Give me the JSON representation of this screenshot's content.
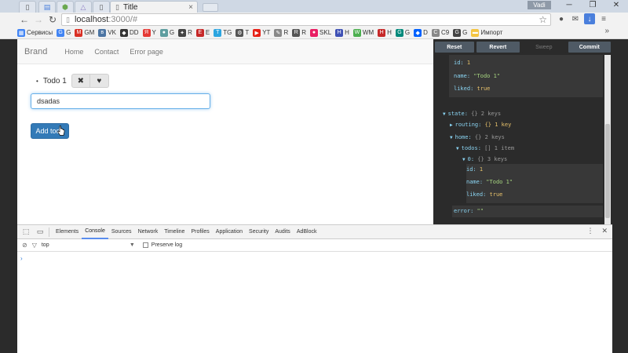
{
  "browser": {
    "tab_title": "Title",
    "url_host": "localhost",
    "url_rest": ":3000/#",
    "user_label": "Vadi",
    "bookmarks": [
      {
        "label": "Сервисы",
        "color": "#4285f4",
        "glyph": "▦"
      },
      {
        "label": "G",
        "color": "#4285f4",
        "glyph": "G"
      },
      {
        "label": "GM",
        "color": "#d93025",
        "glyph": "M"
      },
      {
        "label": "VK",
        "color": "#4c75a3",
        "glyph": "в"
      },
      {
        "label": "DD",
        "color": "#333333",
        "glyph": "◆"
      },
      {
        "label": "Y",
        "color": "#e53935",
        "glyph": "Я"
      },
      {
        "label": "G",
        "color": "#5f9ea0",
        "glyph": "●"
      },
      {
        "label": "R",
        "color": "#444444",
        "glyph": "✦"
      },
      {
        "label": "E",
        "color": "#c62828",
        "glyph": "E"
      },
      {
        "label": "TG",
        "color": "#2ca5e0",
        "glyph": "T"
      },
      {
        "label": "T",
        "color": "#555555",
        "glyph": "⚙"
      },
      {
        "label": "YT",
        "color": "#e62117",
        "glyph": "▶"
      },
      {
        "label": "R",
        "color": "#888888",
        "glyph": "✎"
      },
      {
        "label": "R",
        "color": "#555555",
        "glyph": "R"
      },
      {
        "label": "SKL",
        "color": "#e91e63",
        "glyph": "●"
      },
      {
        "label": "H",
        "color": "#3f51b5",
        "glyph": "H"
      },
      {
        "label": "WM",
        "color": "#4caf50",
        "glyph": "W"
      },
      {
        "label": "H",
        "color": "#c62828",
        "glyph": "H"
      },
      {
        "label": "G",
        "color": "#00897b",
        "glyph": "G"
      },
      {
        "label": "D",
        "color": "#0061fe",
        "glyph": "◆"
      },
      {
        "label": "C9",
        "color": "#888888",
        "glyph": "C"
      },
      {
        "label": "G",
        "color": "#444444",
        "glyph": "G"
      },
      {
        "label": "Импорт",
        "color": "#f4c542",
        "glyph": "▬"
      }
    ]
  },
  "app": {
    "brand": "Brand",
    "nav": [
      "Home",
      "Contact",
      "Error page"
    ],
    "todo_text": "Todo 1",
    "input_value": "dsadas",
    "add_button": "Add todo"
  },
  "redux": {
    "buttons": [
      "Reset",
      "Revert",
      "Sweep",
      "Commit"
    ],
    "top_item": {
      "id": "1",
      "name": "\"Todo 1\"",
      "liked": "true"
    },
    "state_label": "state:",
    "state_meta": "{}  2 keys",
    "routing_label": "routing:",
    "routing_meta": "{}  1 key",
    "home_label": "home:",
    "home_meta": "{}  2 keys",
    "todos_label": "todos:",
    "todos_meta": "[]  1 item",
    "item_label": "0:",
    "item_meta": "{}  3 keys",
    "item": {
      "id": "1",
      "name": "\"Todo 1\"",
      "liked": "true"
    },
    "error_label": "error:",
    "error_value": "\"\""
  },
  "devtools": {
    "tabs": [
      "Elements",
      "Console",
      "Sources",
      "Network",
      "Timeline",
      "Profiles",
      "Application",
      "Security",
      "Audits",
      "AdBlock"
    ],
    "active_tab": "Console",
    "context": "top",
    "preserve_log": "Preserve log",
    "prompt": "›"
  }
}
